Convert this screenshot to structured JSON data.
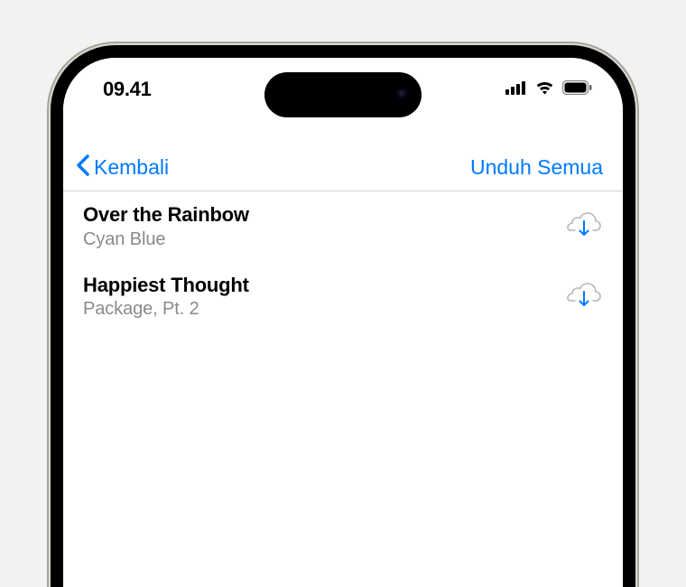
{
  "status_bar": {
    "time": "09.41"
  },
  "nav": {
    "back_label": "Kembali",
    "action_label": "Unduh Semua"
  },
  "items": [
    {
      "title": "Over the Rainbow",
      "subtitle": "Cyan Blue"
    },
    {
      "title": "Happiest Thought",
      "subtitle": "Package, Pt. 2"
    }
  ]
}
